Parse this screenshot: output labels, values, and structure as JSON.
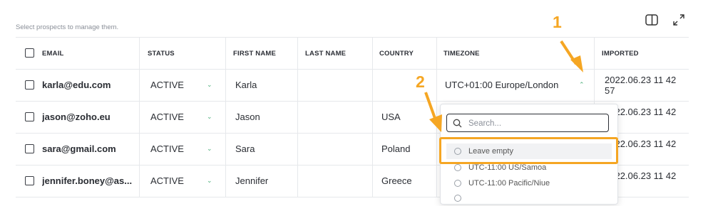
{
  "page": {
    "hint": "Select prospects to manage them.",
    "icons": {
      "split_view": "split-view-icon",
      "expand": "expand-icon"
    }
  },
  "table": {
    "columns": [
      {
        "key": "email",
        "label": "EMAIL"
      },
      {
        "key": "status",
        "label": "STATUS"
      },
      {
        "key": "first_name",
        "label": "FIRST NAME"
      },
      {
        "key": "last_name",
        "label": "LAST NAME"
      },
      {
        "key": "country",
        "label": "COUNTRY"
      },
      {
        "key": "timezone",
        "label": "TIMEZONE"
      },
      {
        "key": "imported",
        "label": "IMPORTED"
      }
    ],
    "rows": [
      {
        "email": "karla@edu.com",
        "status": "ACTIVE",
        "first_name": "Karla",
        "last_name": "",
        "country": "",
        "timezone": "UTC+01:00 Europe/London",
        "imported": "2022.06.23 11 42 57"
      },
      {
        "email": "jason@zoho.eu",
        "status": "ACTIVE",
        "first_name": "Jason",
        "last_name": "",
        "country": "USA",
        "timezone": "",
        "imported": "2022.06.23 11 42 57"
      },
      {
        "email": "sara@gmail.com",
        "status": "ACTIVE",
        "first_name": "Sara",
        "last_name": "",
        "country": "Poland",
        "timezone": "",
        "imported": "2022.06.23 11 42 57"
      },
      {
        "email": "jennifer.boney@as...",
        "status": "ACTIVE",
        "first_name": "Jennifer",
        "last_name": "",
        "country": "Greece",
        "timezone": "",
        "imported": "2022.06.23 11 42 57"
      }
    ]
  },
  "timezone_dropdown": {
    "search_placeholder": "Search...",
    "options": [
      {
        "label": "Leave empty"
      },
      {
        "label": "UTC-11:00 US/Samoa"
      },
      {
        "label": "UTC-11:00 Pacific/Niue"
      },
      {
        "label": ""
      }
    ]
  },
  "annotations": {
    "step1": "1",
    "step2": "2",
    "color": "#f5a623"
  },
  "colors": {
    "accent": "#f5a623",
    "chevron": "#4cae7a",
    "border": "#e6e8eb"
  }
}
